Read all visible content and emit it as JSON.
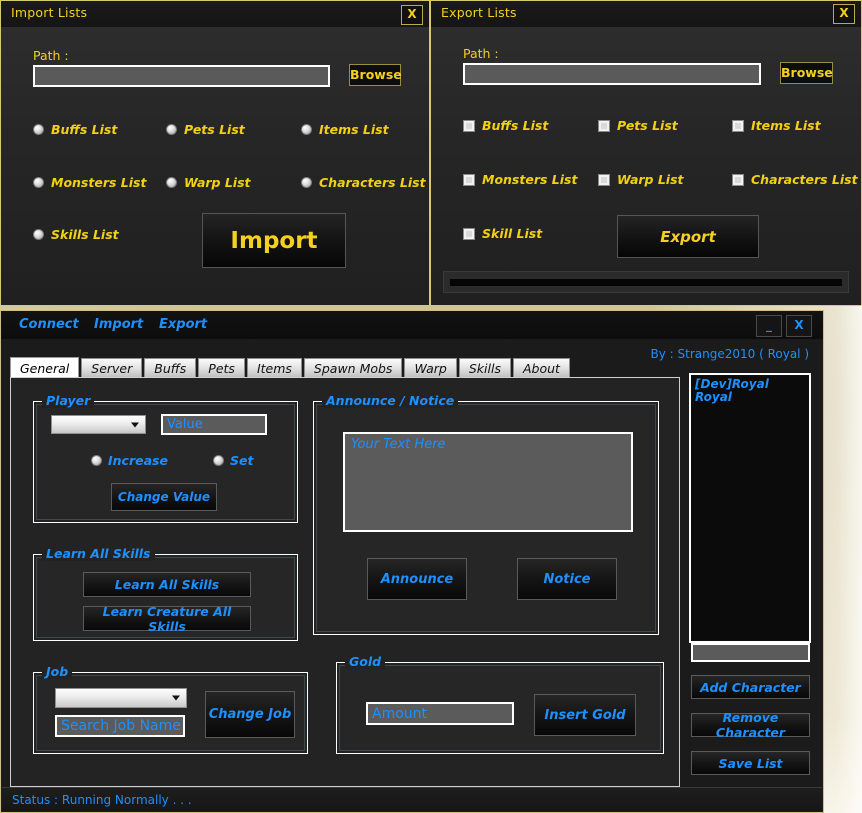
{
  "theme": {
    "yellow": "#f5d020",
    "blue": "#1e90ff",
    "window_bg": "#262626",
    "desktop": "#cbbf92"
  },
  "import_window": {
    "title": "Import Lists",
    "close_label": "X",
    "path_label": "Path :",
    "path_value": "",
    "browse_label": "Browse",
    "options": [
      {
        "label": "Buffs List",
        "checked": false
      },
      {
        "label": "Pets List",
        "checked": false
      },
      {
        "label": "Items List",
        "checked": false
      },
      {
        "label": "Monsters List",
        "checked": false
      },
      {
        "label": "Warp List",
        "checked": false
      },
      {
        "label": "Characters List",
        "checked": false
      },
      {
        "label": "Skills List",
        "checked": false
      }
    ],
    "action_label": "Import"
  },
  "export_window": {
    "title": "Export Lists",
    "close_label": "X",
    "path_label": "Path :",
    "path_value": "",
    "browse_label": "Browse",
    "options": [
      {
        "label": "Buffs List",
        "checked": false
      },
      {
        "label": "Pets List",
        "checked": false
      },
      {
        "label": "Items List",
        "checked": false
      },
      {
        "label": "Monsters List",
        "checked": false
      },
      {
        "label": "Warp List",
        "checked": false
      },
      {
        "label": "Characters List",
        "checked": false
      },
      {
        "label": "Skill List",
        "checked": false
      }
    ],
    "action_label": "Export",
    "progress_percent": 0
  },
  "main_window": {
    "menu": [
      {
        "label": "Connect"
      },
      {
        "label": "Import"
      },
      {
        "label": "Export"
      }
    ],
    "minimize_label": "_",
    "close_label": "X",
    "byline": "By : Strange2010 ( Royal )",
    "tabs": [
      {
        "label": "General",
        "active": true
      },
      {
        "label": "Server",
        "active": false
      },
      {
        "label": "Buffs",
        "active": false
      },
      {
        "label": "Pets",
        "active": false
      },
      {
        "label": "Items",
        "active": false
      },
      {
        "label": "Spawn Mobs",
        "active": false
      },
      {
        "label": "Warp",
        "active": false
      },
      {
        "label": "Skills",
        "active": false
      },
      {
        "label": "About",
        "active": false
      }
    ],
    "player_group": {
      "legend": "Player",
      "stat_select_value": "",
      "value_placeholder": "Value",
      "radio_increase": "Increase",
      "radio_set": "Set",
      "change_value_label": "Change Value"
    },
    "learn_group": {
      "legend": "Learn All Skills",
      "learn_all_label": "Learn All Skills",
      "learn_creature_label": "Learn Creature All Skills"
    },
    "job_group": {
      "legend": "Job",
      "job_select_value": "",
      "search_placeholder": "Search Job Name",
      "change_job_label": "Change Job"
    },
    "announce_group": {
      "legend": "Announce / Notice",
      "text_placeholder": "Your Text Here",
      "announce_label": "Announce",
      "notice_label": "Notice"
    },
    "gold_group": {
      "legend": "Gold",
      "amount_placeholder": "Amount",
      "insert_gold_label": "Insert Gold"
    },
    "character_panel": {
      "list": [
        "[Dev]Royal",
        "Royal"
      ],
      "input_value": "",
      "add_label": "Add Character",
      "remove_label": "Remove Character",
      "save_label": "Save List"
    },
    "status_bar": "Status :  Running Normally . . ."
  }
}
